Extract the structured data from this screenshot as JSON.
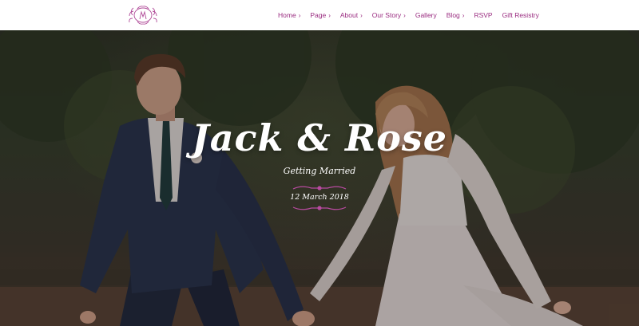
{
  "nav": {
    "items": [
      {
        "label": "Home",
        "has_dropdown": true
      },
      {
        "label": "Page",
        "has_dropdown": true
      },
      {
        "label": "About",
        "has_dropdown": true
      },
      {
        "label": "Our Story",
        "has_dropdown": true
      },
      {
        "label": "Gallery",
        "has_dropdown": false
      },
      {
        "label": "Blog",
        "has_dropdown": true
      },
      {
        "label": "RSVP",
        "has_dropdown": false
      },
      {
        "label": "Gift Resistry",
        "has_dropdown": false
      }
    ]
  },
  "logo": {
    "icon": "monogram-wreath-logo"
  },
  "hero": {
    "title": "Jack & Rose",
    "subtitle": "Getting Married",
    "date": "12 March 2018"
  },
  "colors": {
    "accent": "#9a2c80",
    "text_light": "#ffffff"
  }
}
